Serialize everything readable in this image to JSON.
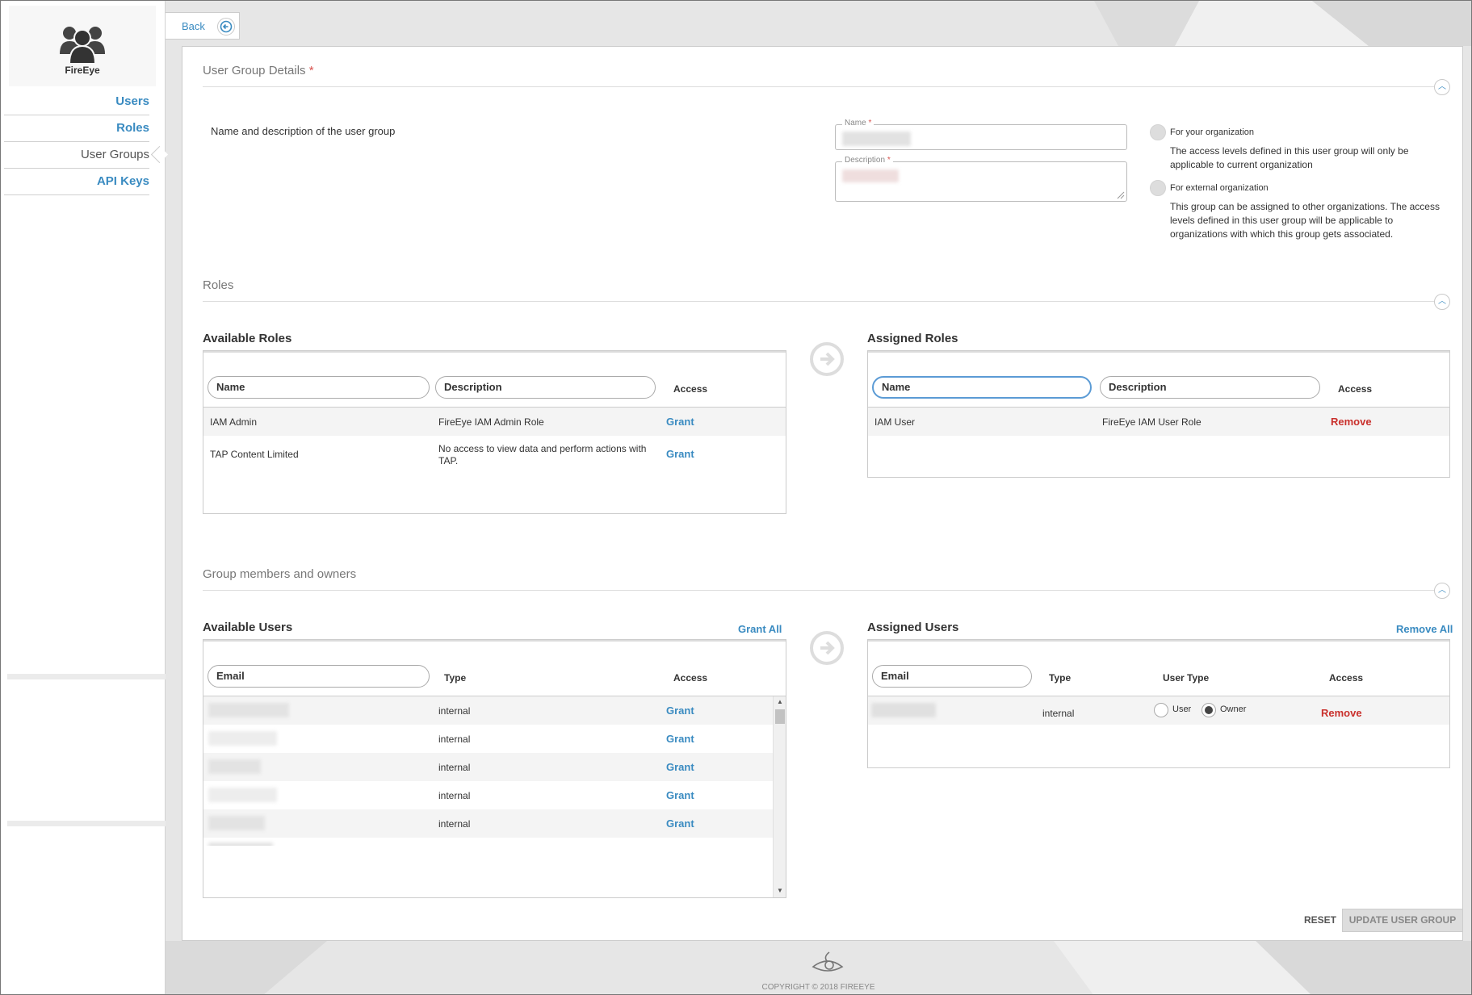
{
  "app": {
    "name": "FireEye"
  },
  "nav": {
    "items": [
      {
        "label": "Users"
      },
      {
        "label": "Roles"
      },
      {
        "label": "User Groups"
      },
      {
        "label": "API Keys"
      }
    ]
  },
  "topbar": {
    "back_label": "Back"
  },
  "details": {
    "title": "User Group Details",
    "required_mark": "*",
    "intro": "Name and description of the user group",
    "name_label": "Name *",
    "description_label": "Description *",
    "scope_options": [
      {
        "label": "For your organization",
        "desc": "The access levels defined in this user group will only be applicable to current organization"
      },
      {
        "label": "For external organization",
        "desc": "This group can be assigned to other organizations. The access levels defined in this user group will be applicable to organizations with which this group gets associated."
      }
    ]
  },
  "roles": {
    "title": "Roles",
    "available": {
      "title": "Available Roles",
      "headers": {
        "name": "Name",
        "description": "Description",
        "access": "Access"
      },
      "rows": [
        {
          "name": "IAM Admin",
          "description": "FireEye IAM Admin Role",
          "action": "Grant"
        },
        {
          "name": "TAP Content Limited",
          "description": "No access to view data and perform actions with TAP.",
          "action": "Grant"
        }
      ]
    },
    "assigned": {
      "title": "Assigned Roles",
      "headers": {
        "name": "Name",
        "description": "Description",
        "access": "Access"
      },
      "rows": [
        {
          "name": "IAM User",
          "description": "FireEye IAM User Role",
          "action": "Remove"
        }
      ]
    }
  },
  "members": {
    "title": "Group members and owners",
    "available": {
      "title": "Available Users",
      "grant_all": "Grant All",
      "headers": {
        "email": "Email",
        "type": "Type",
        "access": "Access"
      },
      "rows": [
        {
          "type": "internal",
          "action": "Grant"
        },
        {
          "type": "internal",
          "action": "Grant"
        },
        {
          "type": "internal",
          "action": "Grant"
        },
        {
          "type": "internal",
          "action": "Grant"
        },
        {
          "type": "internal",
          "action": "Grant"
        }
      ]
    },
    "assigned": {
      "title": "Assigned Users",
      "remove_all": "Remove All",
      "headers": {
        "email": "Email",
        "type": "Type",
        "user_type": "User Type",
        "access": "Access"
      },
      "rows": [
        {
          "type": "internal",
          "user_label": "User",
          "owner_label": "Owner",
          "selected": "Owner",
          "action": "Remove"
        }
      ]
    }
  },
  "actions": {
    "reset": "RESET",
    "update": "UPDATE USER GROUP"
  },
  "footer": {
    "copyright": "COPYRIGHT © 2018 FIREEYE"
  },
  "colors": {
    "link": "#3a8bc1",
    "danger": "#c9302c",
    "required": "#d9534f"
  }
}
